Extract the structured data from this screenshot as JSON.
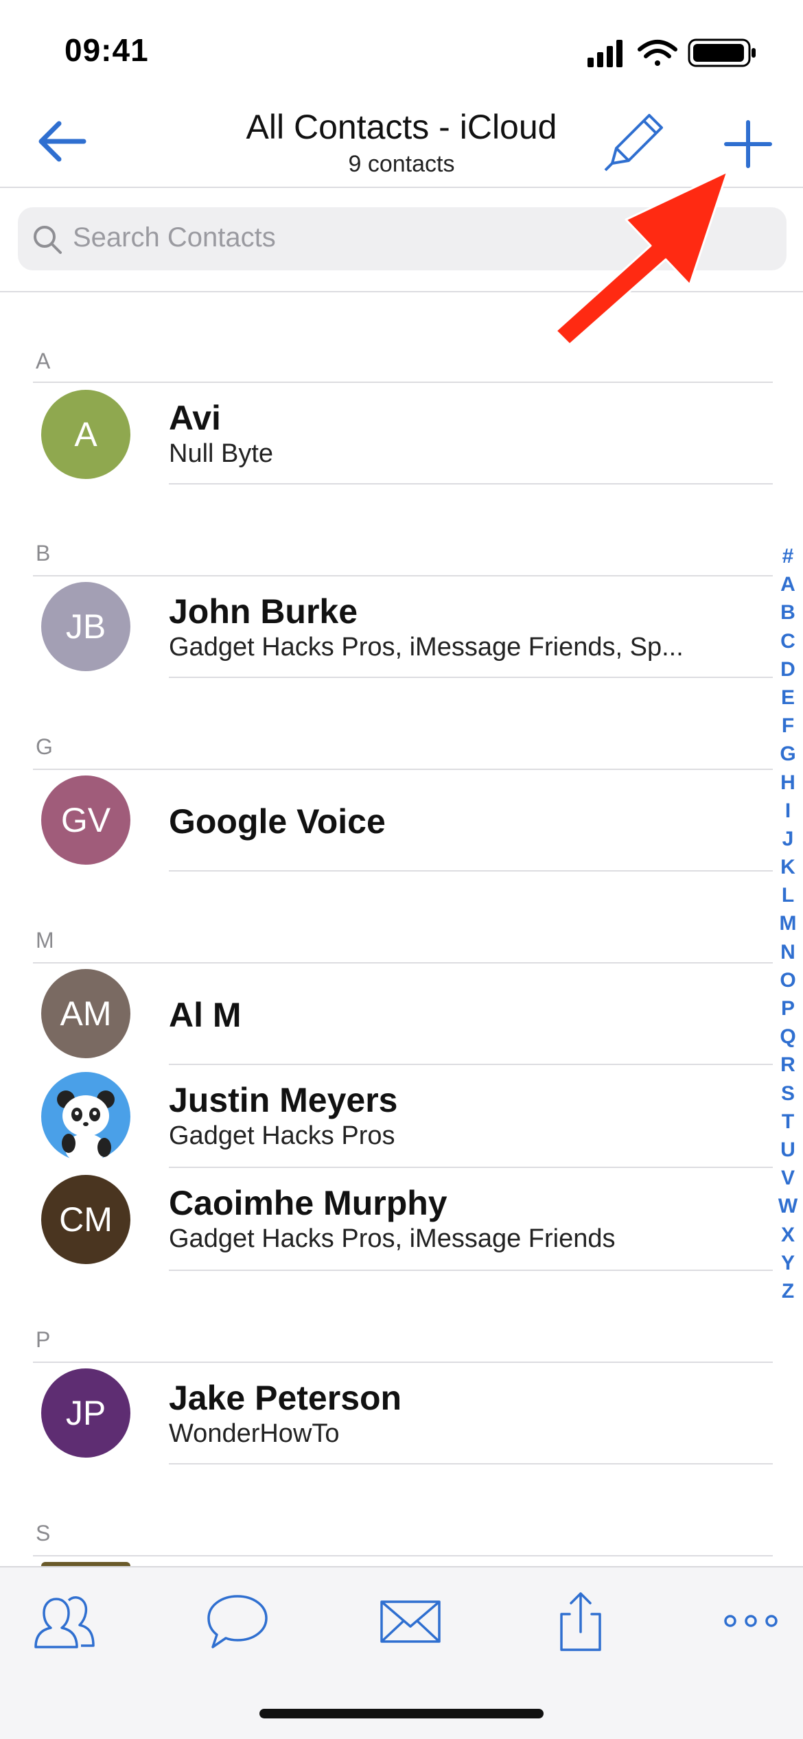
{
  "status_bar": {
    "time": "09:41"
  },
  "nav": {
    "title": "All Contacts - iCloud",
    "subtitle": "9 contacts"
  },
  "search": {
    "placeholder": "Search Contacts"
  },
  "sections": [
    {
      "letter": "A",
      "contacts": [
        {
          "initials": "A",
          "name": "Avi",
          "subtitle": "Null Byte",
          "color": "#8fa84f"
        }
      ]
    },
    {
      "letter": "B",
      "contacts": [
        {
          "initials": "JB",
          "name": "John Burke",
          "subtitle": "Gadget Hacks Pros, iMessage Friends, Sp...",
          "color": "#a39fb4"
        }
      ]
    },
    {
      "letter": "G",
      "contacts": [
        {
          "initials": "GV",
          "name": "Google Voice",
          "subtitle": "",
          "color": "#a05c7a"
        }
      ]
    },
    {
      "letter": "M",
      "contacts": [
        {
          "initials": "AM",
          "name": "Al M",
          "subtitle": "",
          "color": "#7a6a62"
        },
        {
          "initials": "",
          "name": "Justin Meyers",
          "subtitle": "Gadget Hacks Pros",
          "color": "#4aa0e8",
          "avatar_icon": "panda-avatar-icon"
        },
        {
          "initials": "CM",
          "name": "Caoimhe Murphy",
          "subtitle": "Gadget Hacks Pros, iMessage Friends",
          "color": "#4a3520"
        }
      ]
    },
    {
      "letter": "P",
      "contacts": [
        {
          "initials": "JP",
          "name": "Jake Peterson",
          "subtitle": "WonderHowTo",
          "color": "#5e2d72"
        }
      ]
    },
    {
      "letter": "S",
      "contacts": []
    }
  ],
  "index_letters": [
    "#",
    "A",
    "B",
    "C",
    "D",
    "E",
    "F",
    "G",
    "H",
    "I",
    "J",
    "K",
    "L",
    "M",
    "N",
    "O",
    "P",
    "Q",
    "R",
    "S",
    "T",
    "U",
    "V",
    "W",
    "X",
    "Y",
    "Z"
  ],
  "tab_bar": {
    "items": [
      "contacts-icon",
      "message-bubble-icon",
      "envelope-icon",
      "share-icon",
      "more-dots-icon"
    ]
  },
  "colors": {
    "accent": "#2f6fd0",
    "annotation": "#ff2a12"
  }
}
